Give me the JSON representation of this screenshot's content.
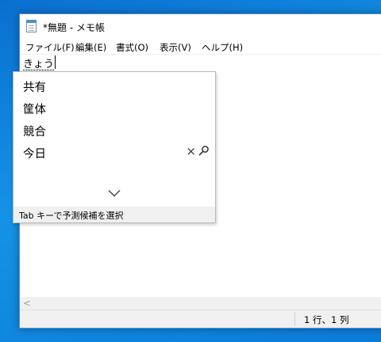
{
  "window": {
    "title": "*無題 - メモ帳"
  },
  "menu": {
    "items": [
      {
        "label": "ファイル(F)"
      },
      {
        "label": "編集(E)"
      },
      {
        "label": "書式(O)"
      },
      {
        "label": "表示(V)"
      },
      {
        "label": "ヘルプ(H)"
      }
    ]
  },
  "editor": {
    "composing_text": "きょう"
  },
  "ime": {
    "candidates": [
      {
        "label": "共有"
      },
      {
        "label": "筐体"
      },
      {
        "label": "競合"
      },
      {
        "label": "今日"
      }
    ],
    "delete_icon": "×",
    "footer_hint": "Tab キーで予測候補を選択"
  },
  "statusbar": {
    "position": "1 行、1 列"
  },
  "scroll": {
    "left_arrow": "<"
  },
  "icons": {
    "app": "notepad-icon",
    "delete": "close-icon",
    "search": "search-icon",
    "expand": "chevron-down-icon",
    "scroll_left": "chevron-left-icon"
  },
  "colors": {
    "desktop": "#0a7bd8",
    "statusbar_bg": "#f0f0f0"
  }
}
